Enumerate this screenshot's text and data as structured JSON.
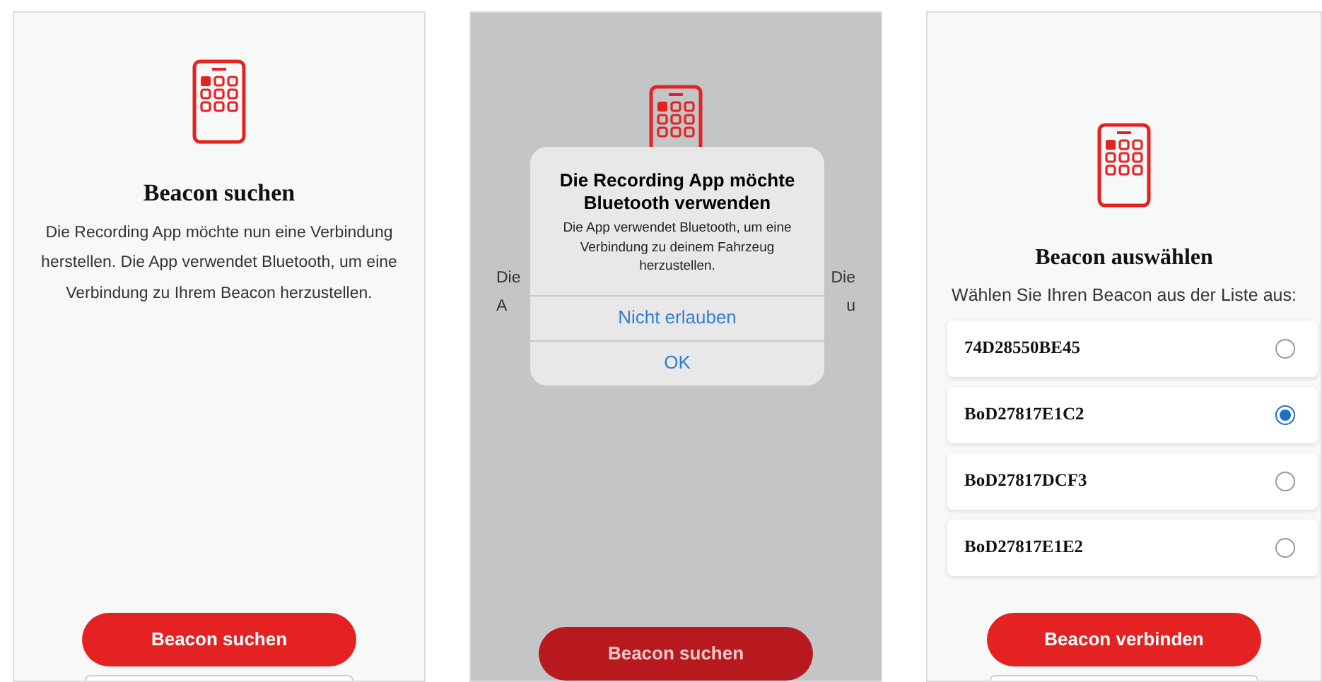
{
  "screens": [
    {
      "kind": "intro",
      "dimmed": false,
      "title": "Beacon suchen",
      "text": "Die Recording App möchte nun eine Verbindung herstellen. Die App verwendet Bluetooth, um eine Verbindung zu Ihrem Beacon herzustellen.",
      "button": {
        "label": "Beacon suchen"
      }
    },
    {
      "kind": "alert",
      "dimmed": true,
      "fragments": [
        {
          "left": "Die",
          "right": "Die"
        },
        {
          "left": "A",
          "right": "u"
        }
      ],
      "dialog": {
        "title": "Die Recording App möchte Bluetooth verwenden",
        "message": "Die App verwendet Bluetooth, um eine Verbindung zu deinem Fahrzeug herzustellen.",
        "buttons": [
          {
            "label": "Nicht erlauben"
          },
          {
            "label": "OK"
          }
        ]
      },
      "button": {
        "label": "Beacon suchen"
      }
    },
    {
      "kind": "list",
      "dimmed": false,
      "title": "Beacon auswählen",
      "subtitle": "Wählen Sie Ihren Beacon aus der Liste aus:",
      "beacons": [
        {
          "id": "74D28550BE45",
          "selected": false
        },
        {
          "id": "BoD27817E1C2",
          "selected": true
        },
        {
          "id": "BoD27817DCF3",
          "selected": false
        },
        {
          "id": "BoD27817E1E2",
          "selected": false
        }
      ],
      "button": {
        "label": "Beacon verbinden"
      }
    }
  ]
}
